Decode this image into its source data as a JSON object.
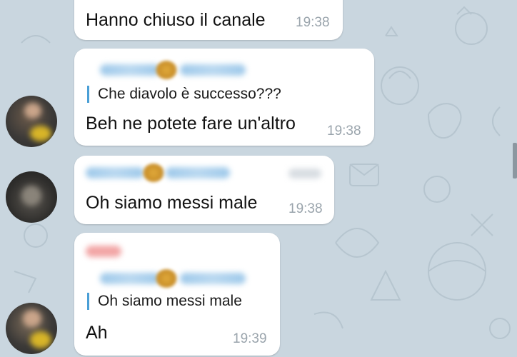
{
  "messages": [
    {
      "text": "Hanno chiuso il canale",
      "time": "19:38"
    },
    {
      "reply_text": "Che diavolo è successo???",
      "text": "Beh ne potete fare un'altro",
      "time": "19:38"
    },
    {
      "text": "Oh siamo messi male",
      "time": "19:38"
    },
    {
      "reply_text": "Oh siamo messi male",
      "text": "Ah",
      "time": "19:39"
    }
  ],
  "colors": {
    "wallpaper": "#c9d6df",
    "bubble": "#ffffff",
    "reply_bar": "#4a9fd6",
    "timestamp": "#9aa4ac"
  }
}
